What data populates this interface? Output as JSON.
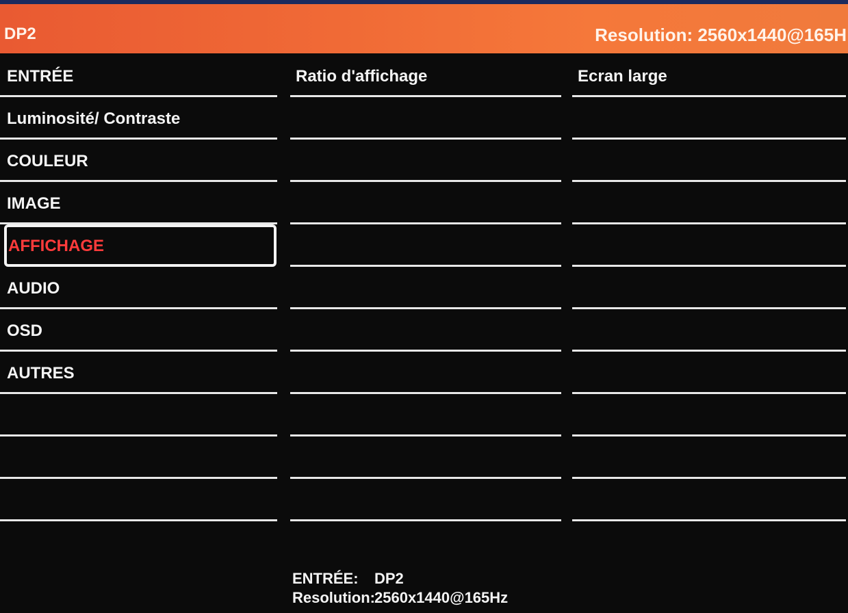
{
  "header": {
    "input": "DP2",
    "resolution": "Resolution:  2560x1440@165H"
  },
  "menu": {
    "items": [
      {
        "label": "ENTRÉE"
      },
      {
        "label": "Luminosité/ Contraste"
      },
      {
        "label": "COULEUR"
      },
      {
        "label": "IMAGE"
      },
      {
        "label": "AFFICHAGE",
        "selected": true
      },
      {
        "label": "AUDIO"
      },
      {
        "label": "OSD"
      },
      {
        "label": "AUTRES"
      },
      {
        "label": ""
      },
      {
        "label": ""
      },
      {
        "label": ""
      }
    ]
  },
  "submenu": {
    "items": [
      {
        "label": "Ratio d'affichage"
      },
      {
        "label": ""
      },
      {
        "label": ""
      },
      {
        "label": ""
      },
      {
        "label": ""
      },
      {
        "label": ""
      },
      {
        "label": ""
      },
      {
        "label": ""
      },
      {
        "label": ""
      },
      {
        "label": ""
      },
      {
        "label": ""
      }
    ]
  },
  "options": {
    "items": [
      {
        "label": "Ecran large"
      },
      {
        "label": ""
      },
      {
        "label": ""
      },
      {
        "label": ""
      },
      {
        "label": ""
      },
      {
        "label": ""
      },
      {
        "label": ""
      },
      {
        "label": ""
      },
      {
        "label": ""
      },
      {
        "label": ""
      },
      {
        "label": ""
      }
    ]
  },
  "footer": {
    "input_key": "ENTRÉE:",
    "input_value": "DP2",
    "resolution_key": "Resolution:",
    "resolution_value": "2560x1440@165Hz"
  },
  "colors": {
    "header": "#f06a36",
    "selected_text": "#ff3b3b",
    "lines": "#e8e8e8"
  }
}
